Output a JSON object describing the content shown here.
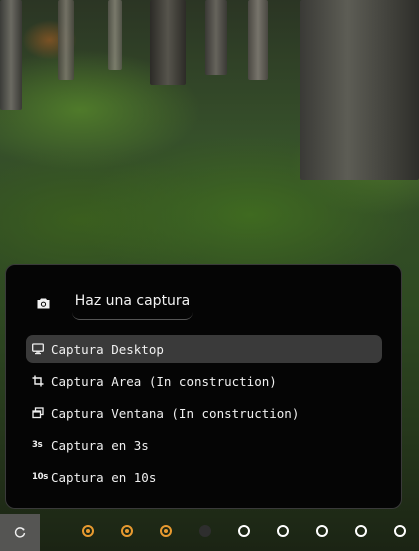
{
  "screenshot_menu": {
    "camera_icon": "camera-icon",
    "title": "Haz una captura",
    "items": [
      {
        "icon": "monitor-icon",
        "label": "Captura Desktop",
        "active": true
      },
      {
        "icon": "crop-icon",
        "label": "Captura Area (In construction)",
        "active": false
      },
      {
        "icon": "window-icon",
        "label": "Captura Ventana (In construction)",
        "active": false
      },
      {
        "icon": "timer-3s-icon",
        "icon_text": "3s",
        "label": "Captura en 3s",
        "active": false
      },
      {
        "icon": "timer-10s-icon",
        "icon_text": "10s",
        "label": "Captura en 10s",
        "active": false
      }
    ]
  },
  "taskbar": {
    "launcher_icon": "launcher-icon",
    "workspaces": [
      {
        "state": "occupied"
      },
      {
        "state": "occupied"
      },
      {
        "state": "occupied"
      },
      {
        "state": "current"
      },
      {
        "state": "empty"
      },
      {
        "state": "empty"
      },
      {
        "state": "empty"
      },
      {
        "state": "empty"
      },
      {
        "state": "empty"
      }
    ]
  },
  "colors": {
    "accent_occupied": "#e89a30",
    "panel_bg": "#050505",
    "active_item_bg": "#3a3a3a",
    "launcher_bg": "#555553"
  }
}
